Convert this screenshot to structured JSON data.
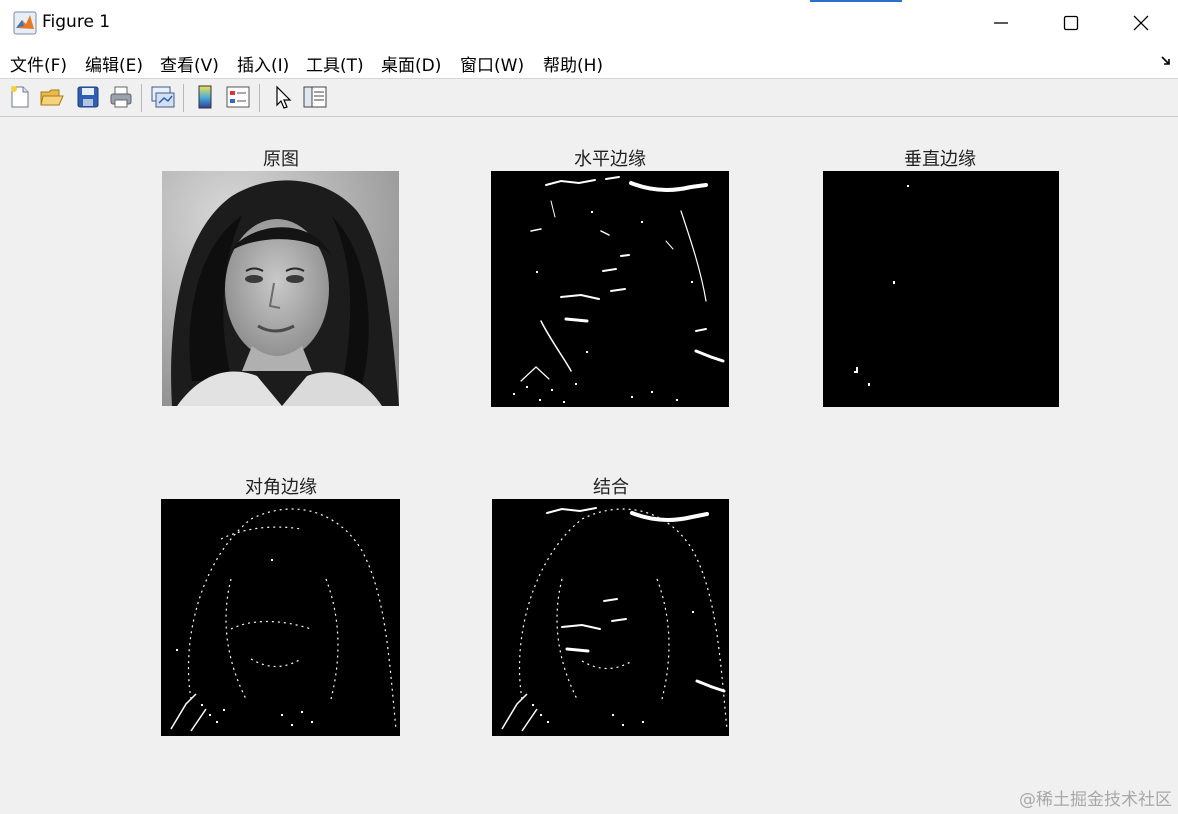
{
  "window": {
    "title": "Figure 1",
    "minimize": "minimize",
    "maximize": "maximize",
    "close": "close"
  },
  "menu": {
    "items": [
      "文件(F)",
      "编辑(E)",
      "查看(V)",
      "插入(I)",
      "工具(T)",
      "桌面(D)",
      "窗口(W)",
      "帮助(H)"
    ]
  },
  "toolbar": {
    "tools": [
      "new-figure",
      "open-file",
      "save-figure",
      "print-figure",
      "link-plot",
      "insert-colorbar",
      "insert-legend",
      "edit-plot",
      "property-inspector"
    ]
  },
  "figure": {
    "panels": [
      {
        "title": "原图",
        "image": "grayscale portrait photo"
      },
      {
        "title": "水平边缘",
        "image": "horizontal edge map"
      },
      {
        "title": "垂直边缘",
        "image": "vertical edge map"
      },
      {
        "title": "对角边缘",
        "image": "diagonal edge map"
      },
      {
        "title": "结合",
        "image": "combined edge map"
      }
    ]
  },
  "watermark": "@稀土掘金技术社区",
  "colors": {
    "background": "#f0f0f0",
    "titlebar": "#ffffff",
    "edge_image_bg": "#000000",
    "edge_pixels": "#ffffff"
  }
}
